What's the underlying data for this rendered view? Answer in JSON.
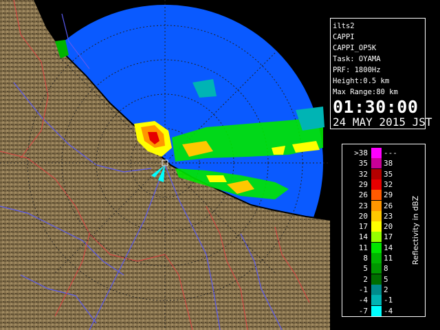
{
  "info_panel": {
    "radar": "ilts2",
    "product": "CAPPI",
    "product_code": "CAPPI_OP5K",
    "task": "Task: OYAMA",
    "prf": "PRF: 1800Hz",
    "height": "Height:0.5 km",
    "max_range": "Max Range:80 km",
    "time": "01:30:00",
    "date": "24 MAY 2015 JST"
  },
  "legend": {
    "title": "Reflectivity in dBZ",
    "rows": [
      {
        "low": ">38",
        "high": "---",
        "color": "#ff00ff"
      },
      {
        "low": "35",
        "high": "38",
        "color": "#c80096"
      },
      {
        "low": "32",
        "high": "35",
        "color": "#b40000"
      },
      {
        "low": "29",
        "high": "32",
        "color": "#e60000"
      },
      {
        "low": "26",
        "high": "29",
        "color": "#ff5a00"
      },
      {
        "low": "23",
        "high": "26",
        "color": "#ff9600"
      },
      {
        "low": "20",
        "high": "23",
        "color": "#ffc800"
      },
      {
        "low": "17",
        "high": "20",
        "color": "#ffff00"
      },
      {
        "low": "14",
        "high": "17",
        "color": "#96ff00"
      },
      {
        "low": "11",
        "high": "14",
        "color": "#00e600"
      },
      {
        "low": "8",
        "high": "11",
        "color": "#00b400"
      },
      {
        "low": "5",
        "high": "8",
        "color": "#009600"
      },
      {
        "low": "2",
        "high": "5",
        "color": "#006e00"
      },
      {
        "low": "-1",
        "high": "2",
        "color": "#008c8c"
      },
      {
        "low": "-4",
        "high": "-1",
        "color": "#00b4b4"
      },
      {
        "low": "-7",
        "high": "-4",
        "color": "#00ffff"
      }
    ]
  },
  "colors": {
    "background": "#000000",
    "radar_coverage": "#0a5aff",
    "inner_coverage": "#1e78ff",
    "land": "#7a6a45",
    "coastline": "#000000",
    "rivers": "#5a5af0",
    "boundaries": "#e04040"
  }
}
